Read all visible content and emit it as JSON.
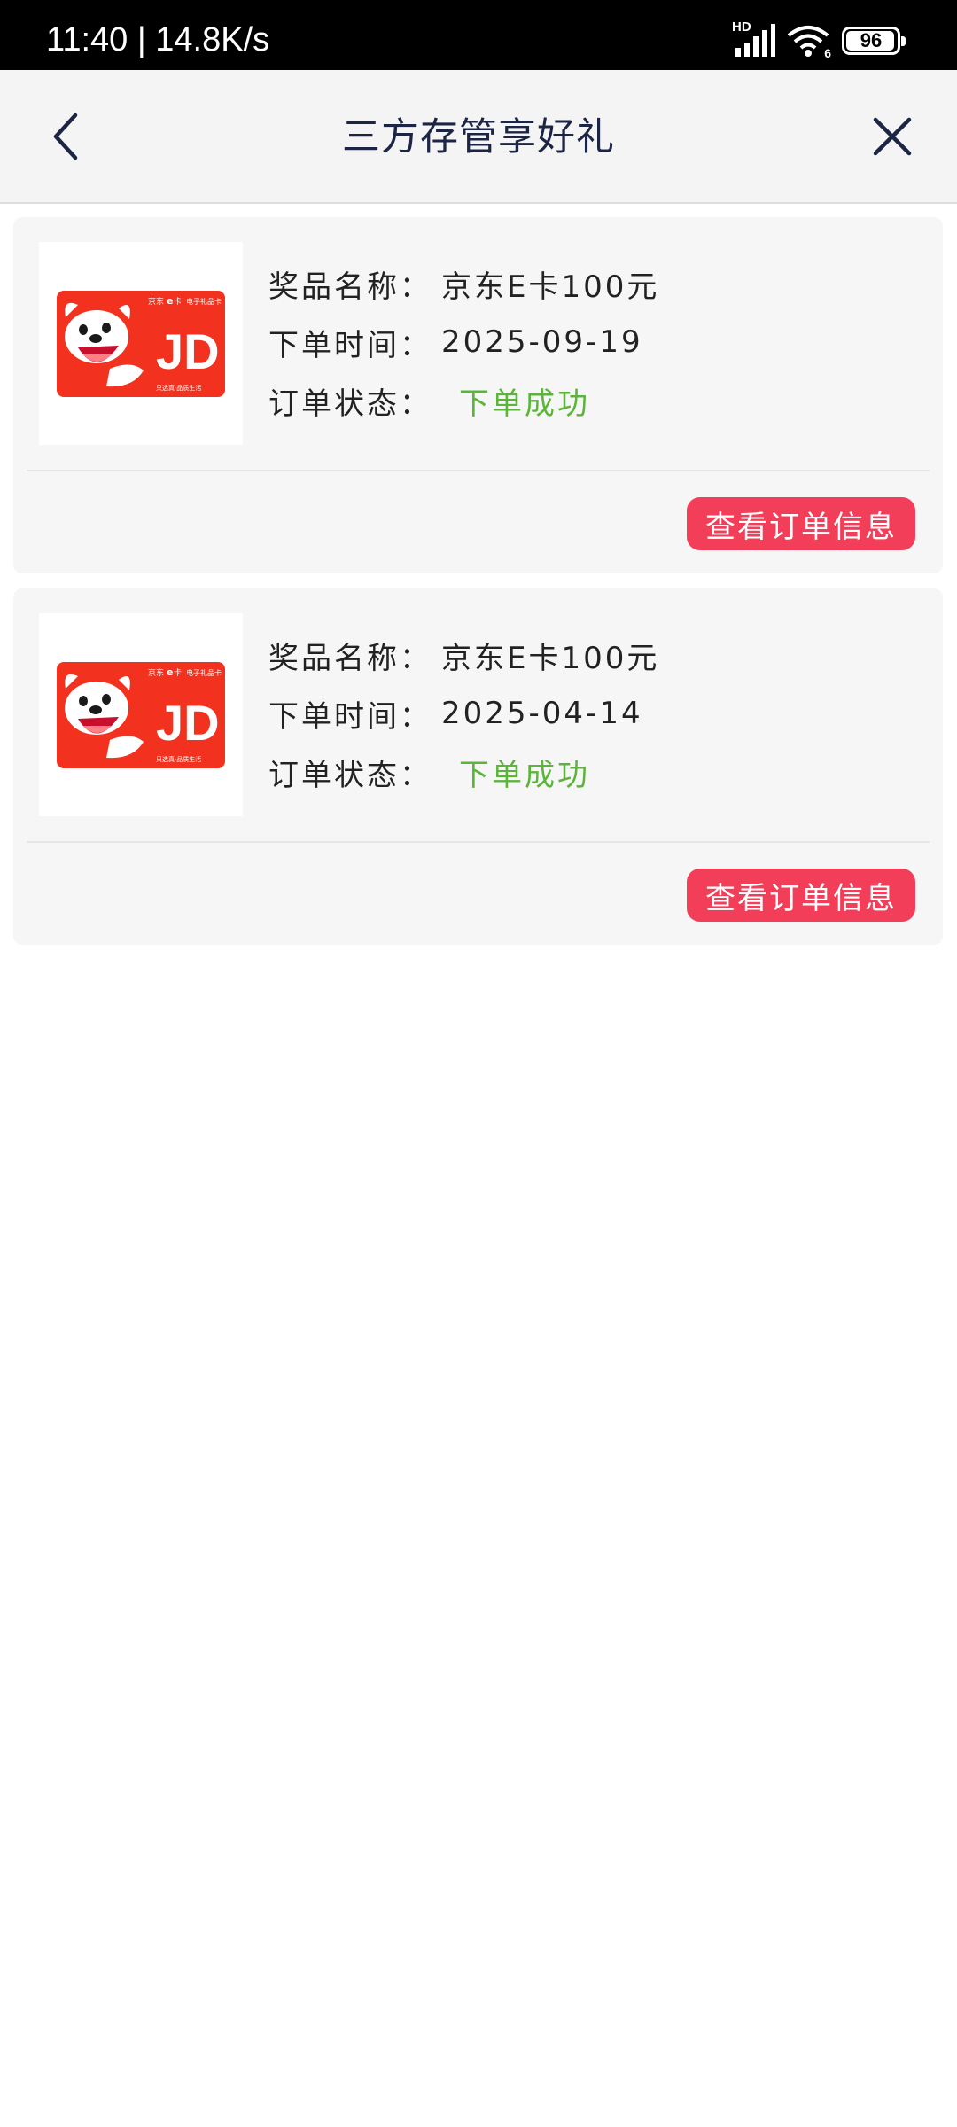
{
  "status_bar": {
    "time": "11:40 | 14.8K/s",
    "network": "HD",
    "wifi_badge": "6",
    "battery": "96",
    "battery_level": 0.96
  },
  "nav": {
    "title": "三方存管享好礼",
    "back_icon": "chevron-left-icon",
    "close_icon": "close-icon"
  },
  "colors": {
    "success": "#5cb53a",
    "button": "#f23e58",
    "card_bg": "#f6f6f6",
    "title": "#1c2543"
  },
  "card_image": {
    "brand_top": "京东",
    "brand_e": "e",
    "brand_ka": "卡",
    "gift_card": "电子礼品卡",
    "logo": "JD",
    "slogan": "只选真·品质生活"
  },
  "orders": [
    {
      "name_label": "奖品名称：",
      "name_value": "京东E卡100元",
      "time_label": "下单时间：",
      "time_value": "2025-09-19",
      "status_label": "订单状态：",
      "status_value": "下单成功",
      "button": "查看订单信息"
    },
    {
      "name_label": "奖品名称：",
      "name_value": "京东E卡100元",
      "time_label": "下单时间：",
      "time_value": "2025-04-14",
      "status_label": "订单状态：",
      "status_value": "下单成功",
      "button": "查看订单信息"
    }
  ]
}
